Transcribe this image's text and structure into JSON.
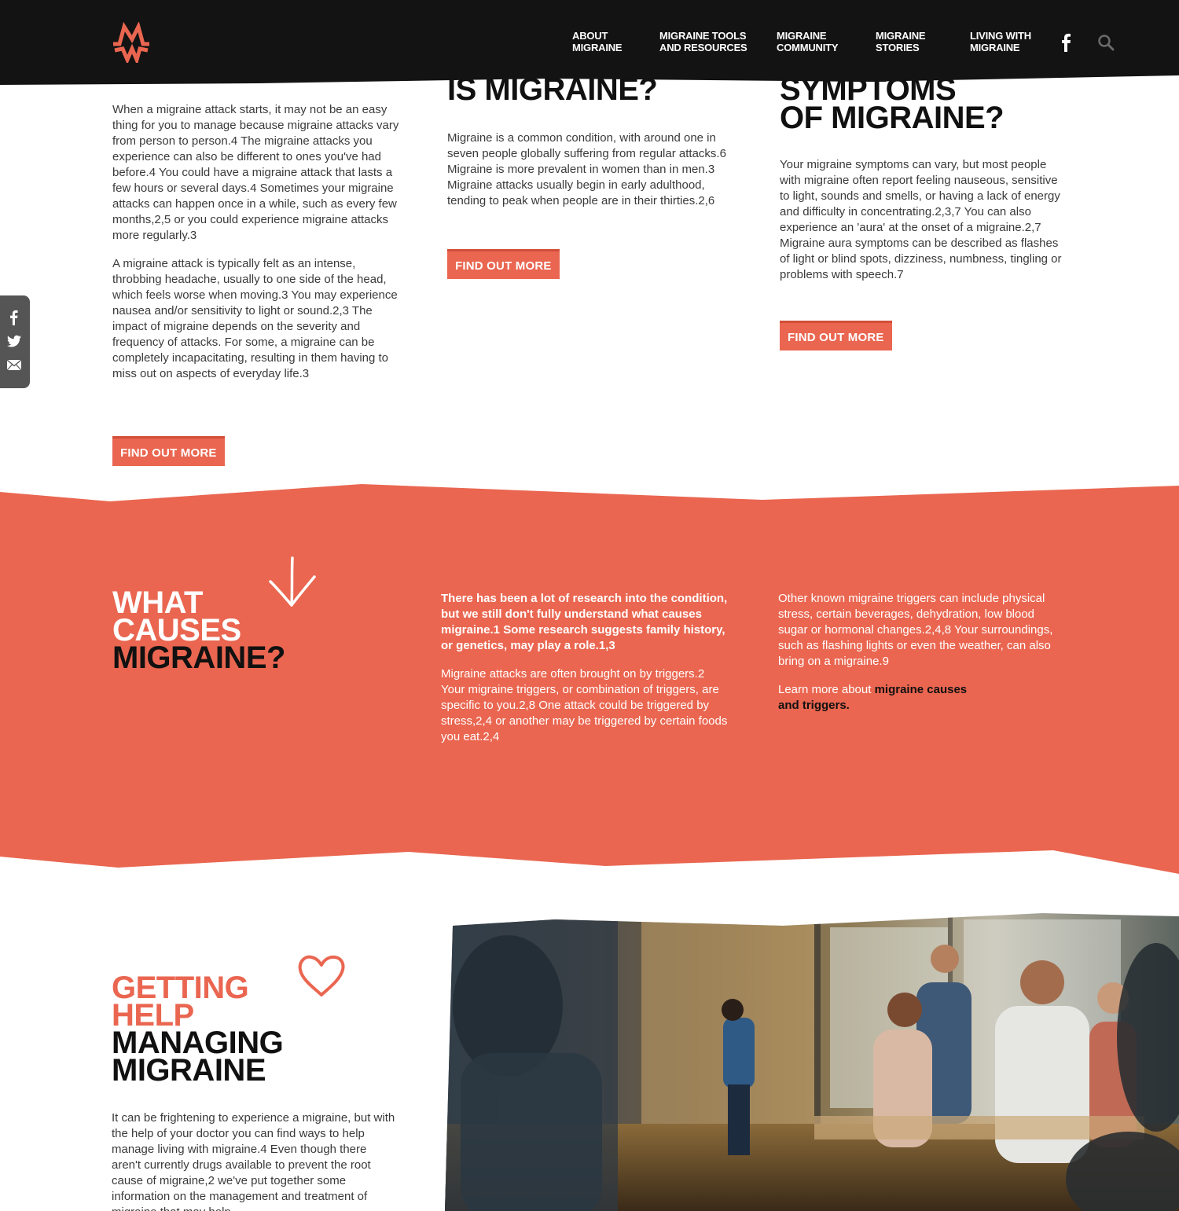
{
  "nav": {
    "items": [
      {
        "line1": "About",
        "line2": "Migraine"
      },
      {
        "line1": "Migraine Tools",
        "line2": "and Resources"
      },
      {
        "line1": "Migraine",
        "line2": "Community"
      },
      {
        "line1": "Migraine",
        "line2": "Stories"
      },
      {
        "line1": "Living with",
        "line2": "Migraine"
      }
    ]
  },
  "col1": {
    "p1": "When a migraine attack starts, it may not be an easy thing for you to manage because migraine attacks vary from person to person.4 The migraine attacks you experience can also be different to ones you've had before.4 You could have a migraine attack that lasts a few hours or several days.4 Sometimes your migraine attacks can happen once in a while, such as every few months,2,5 or you could experience migraine attacks more regularly.3",
    "p2": "A migraine attack is typically felt as an intense, throbbing headache, usually to one side of the head, which feels worse when moving.3 You may experience nausea and/or sensitivity to light or sound.2,3 The impact of migraine depends on the severity and frequency of attacks. For some, a migraine can be completely incapacitating, resulting in them having to miss out on aspects of everyday life.3",
    "button": "Find out more"
  },
  "col2": {
    "heading": "is migraine?",
    "p1": "Migraine is a common condition, with around one in seven people globally suffering from regular attacks.6 Migraine is more prevalent in women than in men.3 Migraine attacks usually begin in early adulthood, tending to peak when people are in their thirties.2,6",
    "button": "Find out more"
  },
  "col3": {
    "heading_line1": "symptoms",
    "heading_line2": "of migraine?",
    "p1": "Your migraine symptoms can vary, but most people with migraine often report feeling nauseous, sensitive to light, sounds and smells, or having a lack of energy and difficulty in concentrating.2,3,7 You can also experience an 'aura' at the onset of a migraine.2,7 Migraine aura symptoms can be described as flashes of light or blind spots, dizziness, numbness, tingling or problems with speech.7",
    "button": "Find out more"
  },
  "causes": {
    "heading_line1": "What",
    "heading_line2": "causes",
    "heading_line3": "migraine?",
    "lead": "There has been a lot of research into the condition, but we still don't fully understand what causes migraine.1 Some research suggests family history, or genetics, may play a role.1,3",
    "p2": "Migraine attacks are often brought on by triggers.2 Your migraine triggers, or combination of triggers, are specific to you.2,8 One attack could be triggered by stress,2,4 or another may be triggered by certain foods you eat.2,4",
    "p3": "Other known migraine triggers can include physical stress, certain beverages, dehydration, low blood sugar or hormonal changes.2,4,8 Your surroundings, such as flashing lights or even the weather, can also bring on a migraine.9",
    "learn_prefix": "Learn more about ",
    "learn_link": "migraine causes and triggers."
  },
  "help": {
    "heading_line1": "Getting",
    "heading_line2": "help",
    "heading_line3": "managing",
    "heading_line4": "migraine",
    "p1": "It can be frightening to experience a migraine, but with the help of your doctor you can find ways to help manage living with migraine.4 Even though there aren't currently drugs available to prevent the root cause of migraine,2 we've put together some information on the management and treatment of migraine that may help."
  },
  "colors": {
    "accent": "#ea6650",
    "header_bg": "#131313",
    "text_dark": "#111111"
  },
  "icons": {
    "logo": "brand-zigzag-logo",
    "social": [
      "facebook-icon",
      "search-icon"
    ],
    "share": [
      "facebook-icon",
      "twitter-icon",
      "mail-icon"
    ],
    "causes_decoration": "arrow-down-icon",
    "help_decoration": "heart-icon"
  }
}
